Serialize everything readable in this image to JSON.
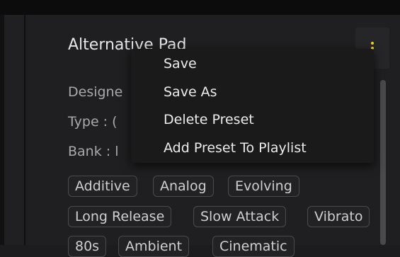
{
  "preset": {
    "name": "Alternative Pad",
    "designer_label": "Designe",
    "type_label": "Type : (",
    "bank_label": "Bank : l"
  },
  "context_menu": {
    "items": [
      "Save",
      "Save As",
      "Delete Preset",
      "Add Preset To Playlist"
    ]
  },
  "tags": {
    "row1": [
      "Additive",
      "Analog",
      "Evolving"
    ],
    "row2": [
      "Long Release",
      "Slow Attack",
      "Vibrato"
    ],
    "row3": [
      "80s",
      "Ambient",
      "Cinematic"
    ]
  },
  "colors": {
    "accent": "#f2d12b",
    "background": "#1f1f21",
    "menu_background": "#1a1a1b",
    "tag_border": "#4a4a4d"
  },
  "icons": {
    "menu_toggle": "vertical-dots-icon"
  }
}
